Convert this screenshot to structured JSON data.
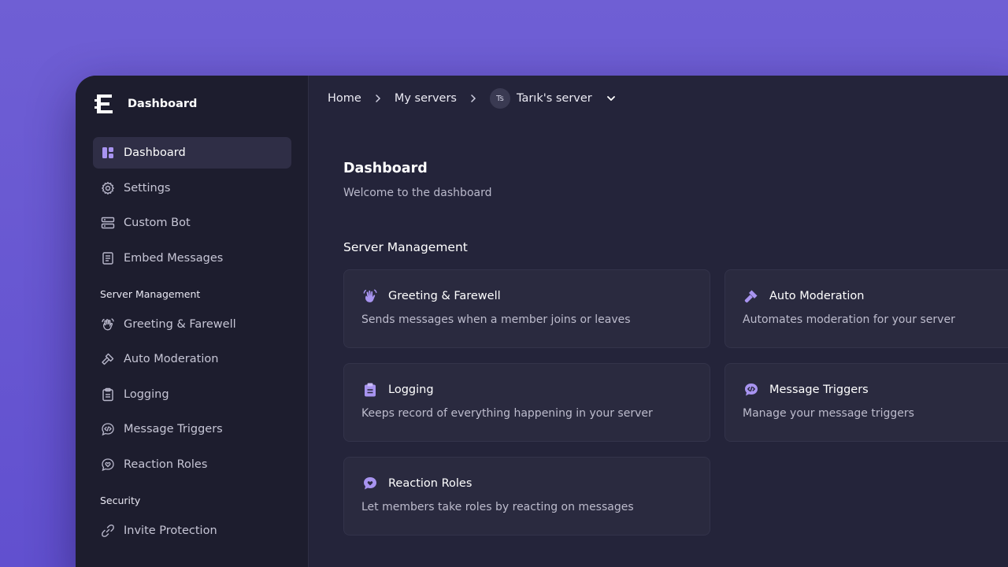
{
  "brand": {
    "title": "Dashboard",
    "icon": "logo-icon"
  },
  "sidebar": {
    "items": [
      {
        "label": "Dashboard",
        "icon": "dashboard-icon",
        "active": true
      },
      {
        "label": "Settings",
        "icon": "gear-icon"
      },
      {
        "label": "Custom Bot",
        "icon": "server-icon"
      },
      {
        "label": "Embed Messages",
        "icon": "document-icon"
      }
    ],
    "sections": [
      {
        "label": "Server Management",
        "items": [
          {
            "label": "Greeting & Farewell",
            "icon": "waving-hand-icon"
          },
          {
            "label": "Auto Moderation",
            "icon": "gavel-icon"
          },
          {
            "label": "Logging",
            "icon": "clipboard-icon"
          },
          {
            "label": "Message Triggers",
            "icon": "code-bubble-icon"
          },
          {
            "label": "Reaction Roles",
            "icon": "heart-bubble-icon"
          }
        ]
      },
      {
        "label": "Security",
        "items": [
          {
            "label": "Invite Protection",
            "icon": "link-icon"
          }
        ]
      }
    ]
  },
  "breadcrumb": {
    "home": "Home",
    "servers": "My servers",
    "server_avatar": "Ts",
    "server_name": "Tarık's server"
  },
  "main": {
    "title": "Dashboard",
    "subtitle": "Welcome to the dashboard",
    "group_title": "Server Management",
    "cards": [
      {
        "title": "Greeting & Farewell",
        "description": "Sends messages when a member joins or leaves",
        "icon": "waving-hand-icon"
      },
      {
        "title": "Auto Moderation",
        "description": "Automates moderation for your server",
        "icon": "gavel-icon"
      },
      {
        "title": "Logging",
        "description": "Keeps record of everything happening in your server",
        "icon": "clipboard-icon"
      },
      {
        "title": "Message Triggers",
        "description": "Manage your message triggers",
        "icon": "code-bubble-icon"
      },
      {
        "title": "Reaction Roles",
        "description": "Let members take roles by reacting on messages",
        "icon": "heart-bubble-icon"
      }
    ]
  },
  "colors": {
    "background": "#6f5fd4",
    "sidebar": "#1d1d2e",
    "main": "#24243a",
    "card": "#2a2a3f",
    "accent": "#a894f0"
  }
}
